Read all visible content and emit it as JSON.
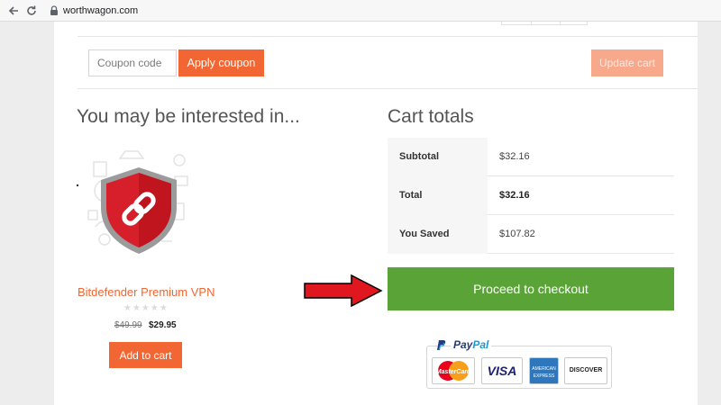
{
  "browser": {
    "url": "worthwagon.com",
    "icons": [
      "back-arrow-icon",
      "reload-icon",
      "lock-icon"
    ]
  },
  "coupon": {
    "placeholder": "Coupon code",
    "apply_label": "Apply coupon",
    "update_label": "Update cart"
  },
  "interest": {
    "title": "You may be interested in...",
    "product": {
      "name": "Bitdefender Premium VPN",
      "old_price": "$49.99",
      "new_price": "$29.95",
      "rating_stars": 0,
      "add_to_cart_label": "Add to cart",
      "image_icon": "shield-chain-link-icon"
    }
  },
  "totals": {
    "title": "Cart totals",
    "rows": [
      {
        "label": "Subtotal",
        "value": "$32.16"
      },
      {
        "label": "Total",
        "value": "$32.16"
      },
      {
        "label": "You Saved",
        "value": "$107.82"
      }
    ],
    "checkout_label": "Proceed to checkout"
  },
  "payment": {
    "paypal_prefix": "Pay",
    "paypal_suffix": "Pal",
    "cards": [
      "MasterCard",
      "VISA",
      "AMERICAN EXPRESS",
      "DISCOVER"
    ]
  },
  "colors": {
    "accent": "#f16632",
    "checkout_green": "#5aa437",
    "arrow_red": "#e0171f"
  }
}
